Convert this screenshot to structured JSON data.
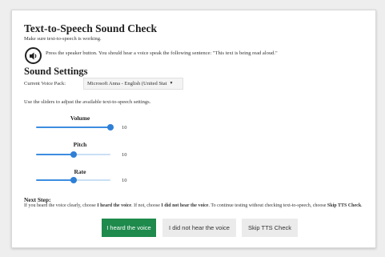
{
  "check": {
    "title": "Text-to-Speech Sound Check",
    "intro": "Make sure text-to-speech is working.",
    "speaker_hint": "Press the speaker button. You should hear a voice speak the following sentence: \"This text is being read aloud.\"",
    "speaker_icon": "speaker-icon"
  },
  "settings": {
    "title": "Sound Settings",
    "voice_label": "Current Voice Pack:",
    "voice_value": "Microsoft Anna - English (United Stat",
    "slider_hint": "Use the sliders to adjust the available text-to-speech settings.",
    "sliders": [
      {
        "label": "Volume",
        "value": "10",
        "level": 1.0
      },
      {
        "label": "Pitch",
        "value": "10",
        "level": 0.5
      },
      {
        "label": "Rate",
        "value": "10",
        "level": 0.5
      }
    ]
  },
  "next_step": {
    "title": "Next Step:",
    "text_1": "If you heard the voice clearly, choose ",
    "heard_bold": "I heard the voice",
    "text_2": ". If not, choose ",
    "not_heard_bold": "I did not hear the voice",
    "text_3": ". To continue testing without checking text-to-speech, choose ",
    "skip_bold": "Skip TTS Check",
    "text_4": "."
  },
  "buttons": {
    "heard": "I heard the voice",
    "not_heard": "I did not hear the voice",
    "skip": "Skip TTS Check"
  },
  "colors": {
    "primary_button": "#1e8a4c",
    "slider_accent": "#2f7fd6"
  }
}
